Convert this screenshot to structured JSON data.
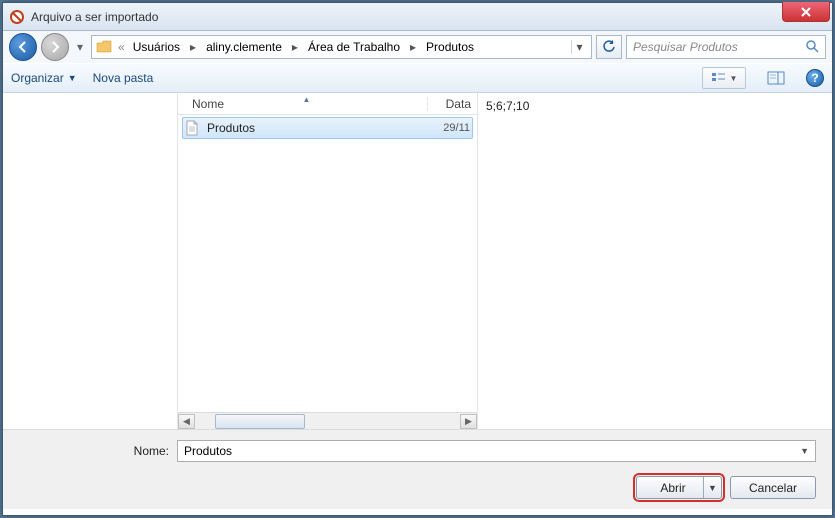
{
  "window": {
    "title": "Arquivo a ser importado"
  },
  "breadcrumb": {
    "segments": [
      "Usuários",
      "aliny.clemente",
      "Área de Trabalho",
      "Produtos"
    ]
  },
  "search": {
    "placeholder": "Pesquisar Produtos"
  },
  "toolbar": {
    "organize": "Organizar",
    "new_folder": "Nova pasta"
  },
  "columns": {
    "name": "Nome",
    "date": "Data"
  },
  "files": [
    {
      "name": "Produtos",
      "date": "29/11"
    }
  ],
  "preview": {
    "text": "5;6;7;10"
  },
  "footer": {
    "name_label": "Nome:",
    "name_value": "Produtos",
    "open": "Abrir",
    "cancel": "Cancelar"
  }
}
